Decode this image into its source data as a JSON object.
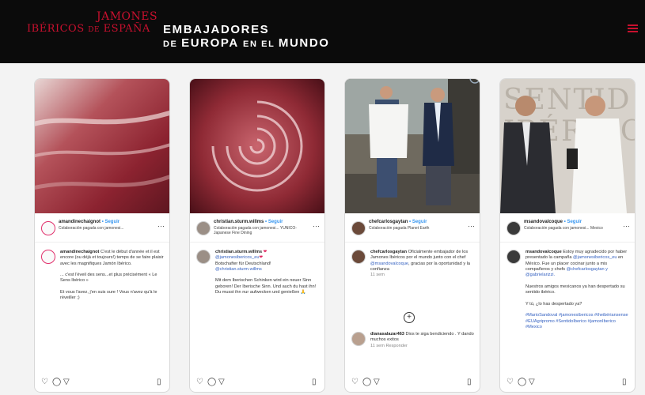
{
  "header": {
    "logo_red_line1": "JAMONES",
    "logo_red_line2a": "IBÉRICOS ",
    "logo_red_line2b": "DE",
    "logo_red_line2c": " ESPAÑA",
    "logo_white_line1": "EMBAJADORES",
    "logo_white_line2a": "DE ",
    "logo_white_line2b": "EUROPA ",
    "logo_white_line2c": "EN EL ",
    "logo_white_line2d": "MUNDO",
    "menu_icon": "hamburger-menu-icon"
  },
  "colors": {
    "header_bg": "#0b0b0b",
    "brand_red": "#c8102e",
    "link": "#3897f0"
  },
  "posts": [
    {
      "username": "amandinechaignot",
      "follow": "Seguir",
      "collab": "Colaboración pagada con jamonesi...",
      "caption_user": "amandinechaignot",
      "caption_body": "C'est le début d'année et il est encore (ou déjà et toujours!) temps de se faire plaisir avec les magnifiques Jamón Ibérico.",
      "caption_body2": "... c'est l'éveil des sens...et plus précisément « Le Sens Ibérico »",
      "caption_body3": "Et vous l'avez, j'en suis sure ! Vous n'avez qu'à le réveiller ;)"
    },
    {
      "username": "christian.sturm.willms",
      "follow": "Seguir",
      "collab": "Colaboración pagada con jamonesi... YUNICO-Japanese Fine Dining",
      "caption_user": "christian.sturm.willms",
      "caption_link": "@jamonesibericos_eu",
      "caption_body": "Botschafter für Deutschland!",
      "caption_link2": "@christian.sturm.willms",
      "caption_body2": "Mit dem Iberischen Schinken wird ein neuer Sinn geboren! Der Iberische Sinn. Und auch du hast ihn! Du musst ihn nur aufwecken und genießen"
    },
    {
      "username": "chefcarlosgaytan",
      "follow": "Seguir",
      "collab": "Colaboración pagada Planet Earth",
      "caption_user": "chefcarlosgaytan",
      "caption_body": "Oficialmente embajador de los Jamones Ibéricos por el mundo junto con el chef",
      "caption_link": "@msandovalcoque",
      "caption_body2": ", gracias por la oportunidad y la confianza",
      "time": "11 sem",
      "reply_user": "dianasalazar463",
      "reply_body": "Dios te siga bendiciendo . Y dando muchos exitos",
      "reply_meta": "11 sem   Responder"
    },
    {
      "username": "msandovalcoque",
      "follow": "Seguir",
      "collab": "Colaboración pagada con jamonesi... Mexico",
      "caption_user": "msandovalcoque",
      "caption_body": "Estoy muy agradecido por haber presentado la campaña",
      "caption_link": "@jamonesibericos_eu",
      "caption_body2": "en México. Fue un placer cocinar junto a mis compañeros y chefs",
      "caption_link2": "@chefcarlosgaytan y @gabrielarizzi.",
      "caption_body3": "Nuestros amigos mexicanos ya han despertado su sentido ibérico.",
      "caption_body4": "Y tú, ¿lo has despertado ya?",
      "hashtags": "#MarioSandoval #jamonesibericos #theibériansense #EUAgripromo #SentidoIberico #jamonIberico #Mexico"
    }
  ],
  "photo_text": {
    "sign": "SENTID IBÉRICO"
  }
}
